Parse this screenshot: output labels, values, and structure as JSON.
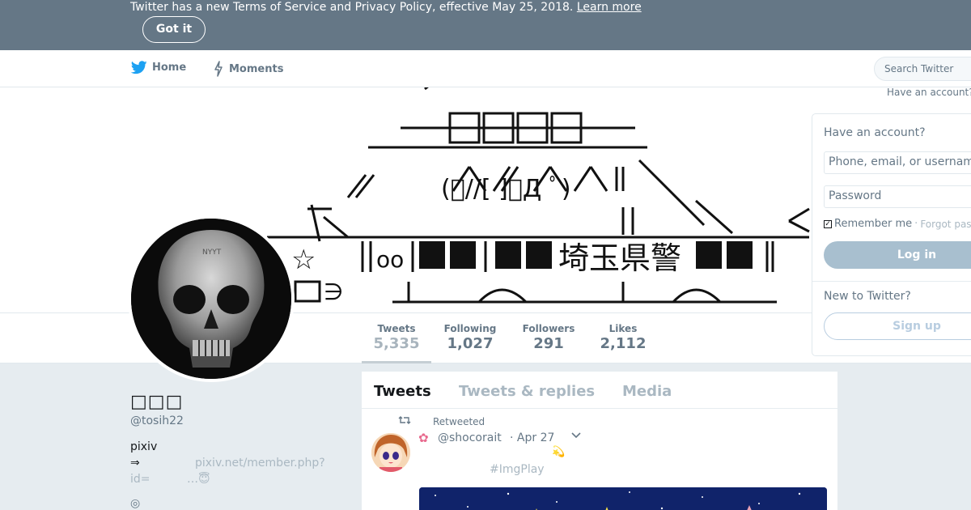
{
  "banner": {
    "text": "Twitter has a new Terms of Service and Privacy Policy, effective May 25, 2018.",
    "learn_more": "Learn more",
    "got_it": "Got it"
  },
  "nav": {
    "home": "Home",
    "moments": "Moments",
    "search_placeholder": "Search Twitter",
    "have_account": "Have an account?"
  },
  "stats": {
    "tweets_label": "Tweets",
    "tweets_value": "5,335",
    "following_label": "Following",
    "following_value": "1,027",
    "followers_label": "Followers",
    "followers_value": "291",
    "likes_label": "Likes",
    "likes_value": "2,112"
  },
  "profile": {
    "name": "□□□",
    "handle": "@tosih22",
    "bio_line1": "pixiv",
    "bio_line2": "⇒",
    "bio_link": "pixiv.net/member.php?",
    "bio_line3": "id=",
    "bio_ellipsis": "…😇",
    "location_icon": "◎"
  },
  "timeline": {
    "tab_tweets": "Tweets",
    "tab_replies": "Tweets & replies",
    "tab_media": "Media",
    "retweeted_label": "Retweeted",
    "tweet_handle": "@shocorait",
    "tweet_date": "· Apr 27",
    "tweet_hashtag": "#ImgPlay",
    "tweet_star": "💫"
  },
  "login": {
    "title": "Have an account?",
    "user_placeholder": "Phone, email, or username",
    "password_placeholder": "Password",
    "remember": "Remember me",
    "separator": "·",
    "forgot": "Forgot password?",
    "login_button": "Log in",
    "new_title": "New to Twitter?",
    "signup_button": "Sign up"
  },
  "header_art": {
    "line_sign": "埼玉県警"
  },
  "colors": {
    "banner": "#657786",
    "accent": "#1da1f2",
    "muted": "#657786",
    "background": "#e6ecf0"
  }
}
